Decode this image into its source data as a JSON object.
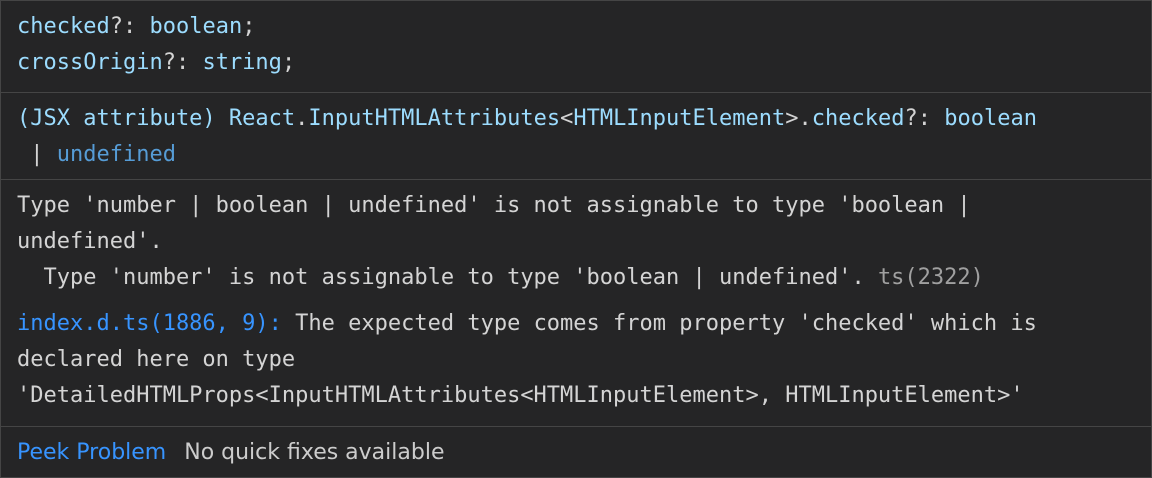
{
  "code_section": {
    "line1": {
      "name": "checked",
      "punct": "?: ",
      "type": "boolean",
      "end": ";"
    },
    "line2": {
      "name": "crossOrigin",
      "punct": "?: ",
      "type": "string",
      "end": ";"
    }
  },
  "signature": {
    "prefix": "(JSX attribute) ",
    "ns": "React",
    "dot1": ".",
    "iface": "InputHTMLAttributes",
    "lt": "<",
    "generic": "HTMLInputElement",
    "gt": ">",
    "dot2": ".",
    "prop": "checked",
    "punct": "?: ",
    "type1": "boolean",
    "line2_pipe": " | ",
    "type2": "undefined"
  },
  "diagnostic": {
    "line1": "Type 'number | boolean | undefined' is not assignable to type 'boolean |",
    "line2": "undefined'.",
    "line3": "  Type 'number' is not assignable to type 'boolean | undefined'. ",
    "code": "ts(2322)",
    "related_link": "index.d.ts(1886, 9):",
    "related_text": " The expected type comes from property 'checked' which is",
    "related_line2": "declared here on type",
    "related_line3": "'DetailedHTMLProps<InputHTMLAttributes<HTMLInputElement>, HTMLInputElement>'"
  },
  "status_bar": {
    "peek_label": "Peek Problem",
    "no_fix_label": "No quick fixes available"
  },
  "colors": {
    "background": "#252526",
    "border": "#454545",
    "variable": "#9cdcfe",
    "link": "#3794ff"
  }
}
